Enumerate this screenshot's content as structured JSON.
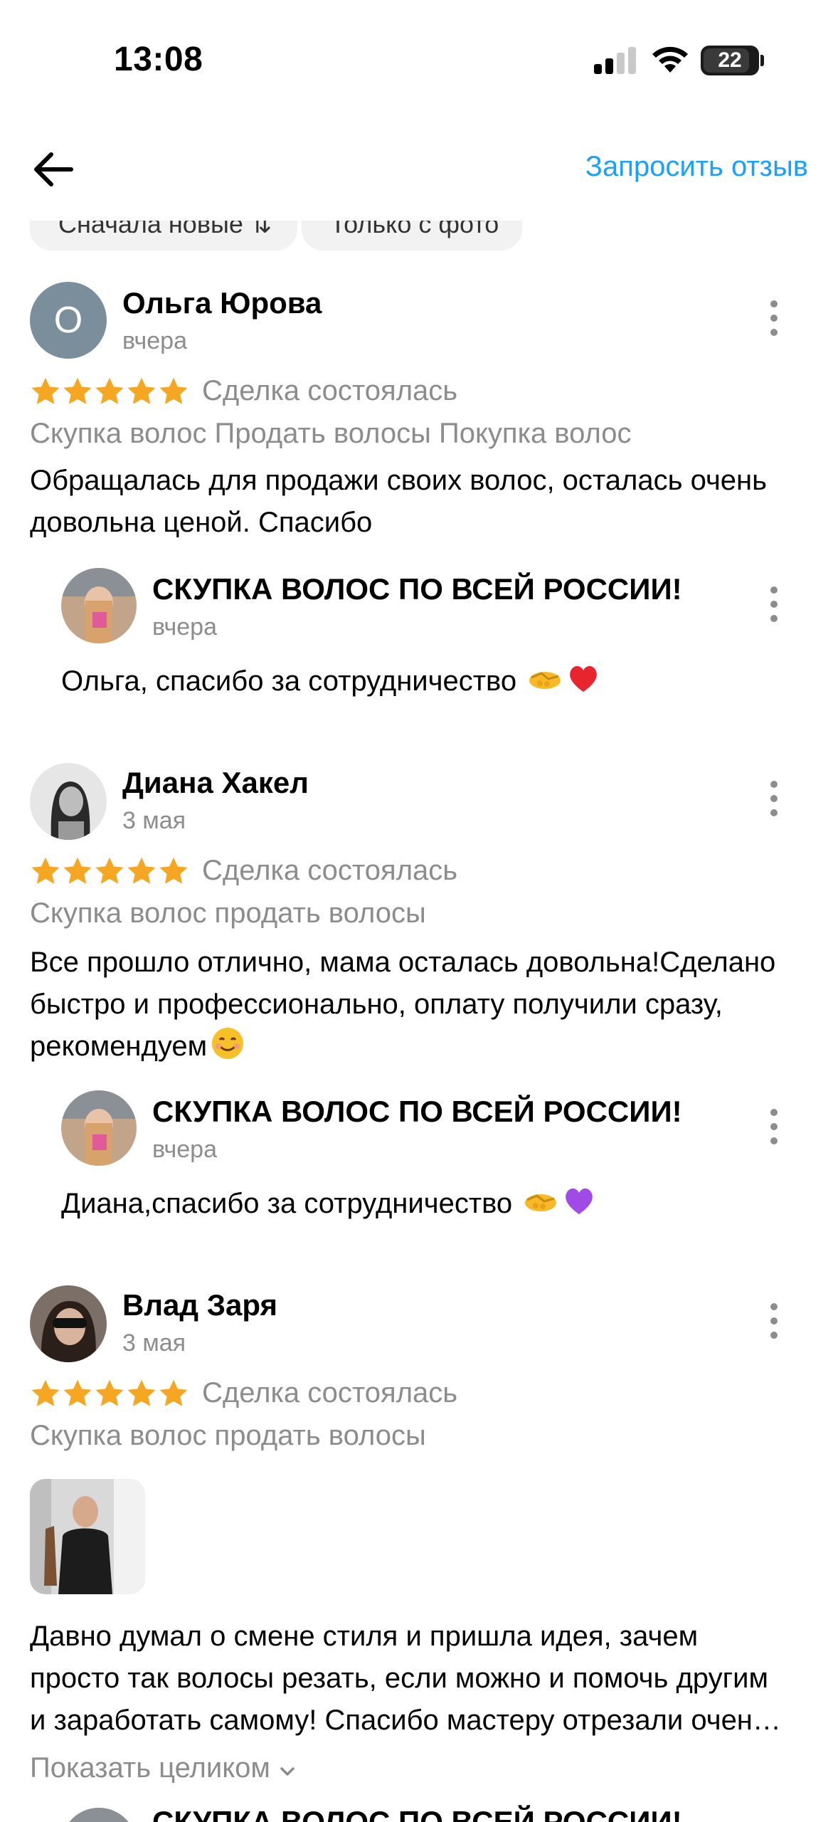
{
  "status_bar": {
    "time": "13:08",
    "battery": "22"
  },
  "nav": {
    "request_review": "Запросить отзыв"
  },
  "filters": {
    "sort_label": "Сначала новые",
    "photo_label": "Только с фото"
  },
  "reviews": [
    {
      "author": "Ольга Юрова",
      "avatar_letter": "О",
      "date": "вчера",
      "rating": 5,
      "deal": "Сделка состоялась",
      "tags": "Скупка волос Продать волосы Покупка волос",
      "text_lines": [
        "Обращалась для продажи своих волос, осталась очень",
        "довольна ценой. Спасибо"
      ],
      "reply": {
        "author": "СКУПКА ВОЛОС ПО ВСЕЙ РОССИИ!",
        "date": "вчера",
        "text": "Ольга, спасибо за сотрудничество",
        "emojis": [
          "handshake-emoji",
          "red-heart-emoji"
        ]
      }
    },
    {
      "author": "Диана Хакел",
      "date": "3 мая",
      "rating": 5,
      "deal": "Сделка состоялась",
      "tags": "Скупка волос продать волосы",
      "text_lines": [
        "Все прошло отлично, мама осталась довольна!Сделано",
        "быстро и профессионально, оплату получили сразу,",
        "рекомендуем"
      ],
      "reply": {
        "author": "СКУПКА ВОЛОС ПО ВСЕЙ РОССИИ!",
        "date": "вчера",
        "text": "Диана,спасибо за сотрудничество",
        "emojis": [
          "handshake-emoji",
          "purple-heart-emoji"
        ]
      }
    },
    {
      "author": "Влад Заря",
      "date": "3 мая",
      "rating": 5,
      "deal": "Сделка состоялась",
      "tags": "Скупка волос продать волосы",
      "text_lines": [
        "Давно думал о смене стиля и пришла идея, зачем",
        "просто так волосы резать, если можно и помочь другим",
        "и заработать самому! Спасибо мастеру отрезали очен…"
      ],
      "show_full": "Показать целиком",
      "reply": {
        "author": "СКУПКА ВОЛОС ПО ВСЕЙ РОССИИ!"
      }
    }
  ],
  "colors": {
    "accent": "#1aa0ff",
    "star": "#f5a623",
    "muted": "#8c8c8c"
  }
}
